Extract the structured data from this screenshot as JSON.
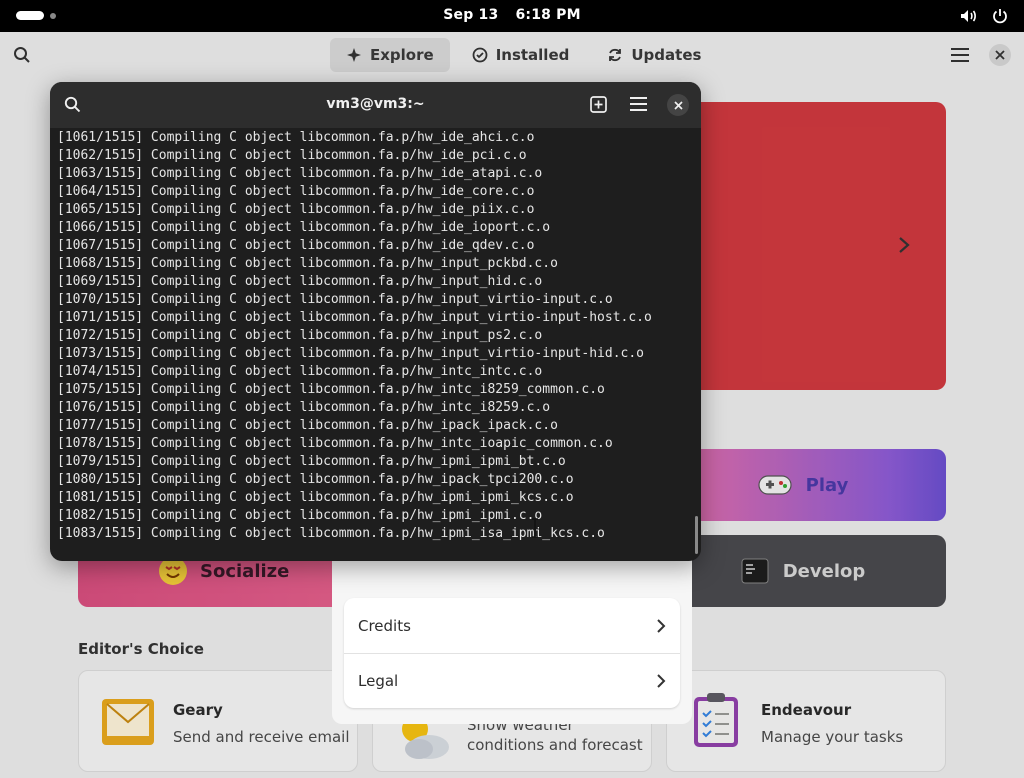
{
  "topbar": {
    "date": "Sep 13",
    "time": "6:18 PM"
  },
  "app": {
    "tabs": [
      {
        "label": "Explore",
        "icon": "explore-icon"
      },
      {
        "label": "Installed",
        "icon": "check-circle-icon"
      },
      {
        "label": "Updates",
        "icon": "refresh-icon"
      }
    ],
    "categories": {
      "play": "Play",
      "develop": "Develop",
      "socialize": "Socialize"
    },
    "editors_choice": {
      "title": "Editor's Choice",
      "items": [
        {
          "name": "Geary",
          "desc": "Send and receive email"
        },
        {
          "name": "",
          "desc": "Show weather\nconditions and forecast"
        },
        {
          "name": "Endeavour",
          "desc": "Manage your tasks"
        }
      ]
    }
  },
  "about_dialog": {
    "rows": [
      {
        "label": "Credits"
      },
      {
        "label": "Legal"
      }
    ]
  },
  "terminal": {
    "title": "vm3@vm3:~",
    "lines": [
      "[1061/1515] Compiling C object libcommon.fa.p/hw_ide_ahci.c.o",
      "[1062/1515] Compiling C object libcommon.fa.p/hw_ide_pci.c.o",
      "[1063/1515] Compiling C object libcommon.fa.p/hw_ide_atapi.c.o",
      "[1064/1515] Compiling C object libcommon.fa.p/hw_ide_core.c.o",
      "[1065/1515] Compiling C object libcommon.fa.p/hw_ide_piix.c.o",
      "[1066/1515] Compiling C object libcommon.fa.p/hw_ide_ioport.c.o",
      "[1067/1515] Compiling C object libcommon.fa.p/hw_ide_qdev.c.o",
      "[1068/1515] Compiling C object libcommon.fa.p/hw_input_pckbd.c.o",
      "[1069/1515] Compiling C object libcommon.fa.p/hw_input_hid.c.o",
      "[1070/1515] Compiling C object libcommon.fa.p/hw_input_virtio-input.c.o",
      "[1071/1515] Compiling C object libcommon.fa.p/hw_input_virtio-input-host.c.o",
      "[1072/1515] Compiling C object libcommon.fa.p/hw_input_ps2.c.o",
      "[1073/1515] Compiling C object libcommon.fa.p/hw_input_virtio-input-hid.c.o",
      "[1074/1515] Compiling C object libcommon.fa.p/hw_intc_intc.c.o",
      "[1075/1515] Compiling C object libcommon.fa.p/hw_intc_i8259_common.c.o",
      "[1076/1515] Compiling C object libcommon.fa.p/hw_intc_i8259.c.o",
      "[1077/1515] Compiling C object libcommon.fa.p/hw_ipack_ipack.c.o",
      "[1078/1515] Compiling C object libcommon.fa.p/hw_intc_ioapic_common.c.o",
      "[1079/1515] Compiling C object libcommon.fa.p/hw_ipmi_ipmi_bt.c.o",
      "[1080/1515] Compiling C object libcommon.fa.p/hw_ipack_tpci200.c.o",
      "[1081/1515] Compiling C object libcommon.fa.p/hw_ipmi_ipmi_kcs.c.o",
      "[1082/1515] Compiling C object libcommon.fa.p/hw_ipmi_ipmi.c.o",
      "[1083/1515] Compiling C object libcommon.fa.p/hw_ipmi_isa_ipmi_kcs.c.o"
    ]
  },
  "colors": {
    "banner": "#d0393f",
    "terminal_bg": "#1e1e1e",
    "develop_tile": "#4a4a4e"
  }
}
